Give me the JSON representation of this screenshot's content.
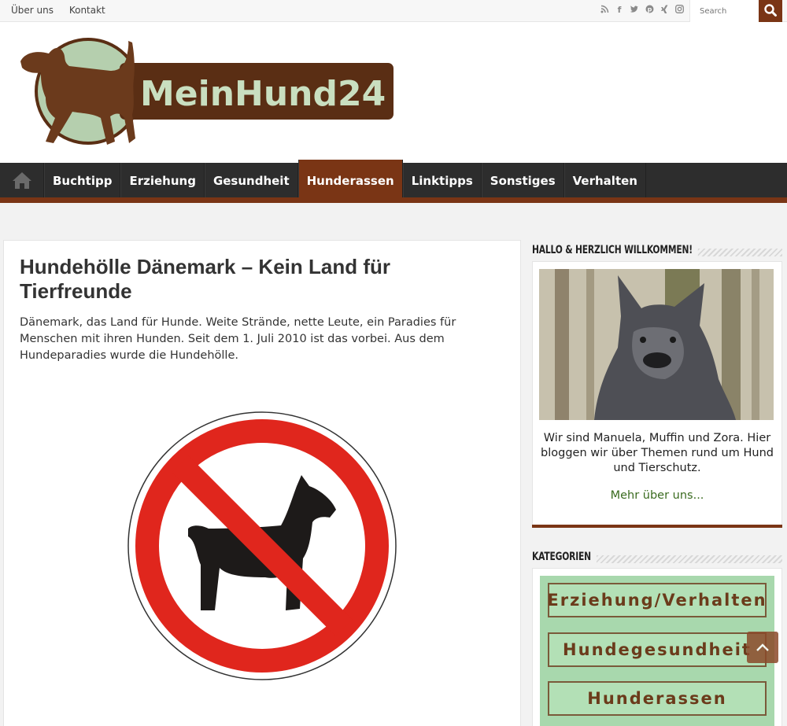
{
  "topbar": {
    "links": [
      "Über uns",
      "Kontakt"
    ],
    "social_icons": [
      "rss-icon",
      "facebook-icon",
      "twitter-icon",
      "pinterest-icon",
      "xing-icon",
      "instagram-icon"
    ],
    "search_placeholder": "Search"
  },
  "header": {
    "logo_text": "MeinHund24"
  },
  "nav": {
    "items": [
      "Buchtipp",
      "Erziehung",
      "Gesundheit",
      "Hunderassen",
      "Linktipps",
      "Sonstiges",
      "Verhalten"
    ],
    "active": "Hunderassen"
  },
  "article": {
    "title": "Hundehölle Dänemark – Kein Land für Tierfreunde",
    "excerpt": "Dänemark, das Land für Hunde. Weite Strände, nette Leute, ein Paradies für Menschen mit ihren Hunden. Seit dem 1. Juli 2010 ist das vorbei. Aus dem Hundeparadies wurde die Hundehölle."
  },
  "sidebar": {
    "welcome_title": "HALLO & HERZLICH WILLKOMMEN!",
    "welcome_text": "Wir sind Manuela, Muffin und Zora. Hier bloggen wir über Themen rund um Hund und Tierschutz.",
    "welcome_link": "Mehr über uns...",
    "categories_title": "KATEGORIEN",
    "categories": [
      "Erziehung/Verhalten",
      "Hundegesundheit",
      "Hunderassen"
    ]
  },
  "colors": {
    "brand_brown": "#7a3515",
    "nav_bg": "#2d2d2d",
    "link_green": "#3a6b1f",
    "category_green": "#a8d8ad"
  }
}
